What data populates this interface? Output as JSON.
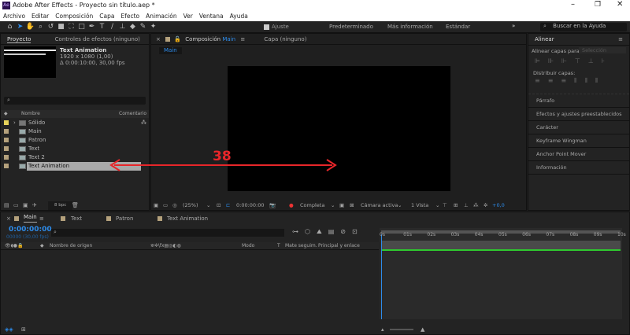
{
  "window": {
    "title": "Adobe After Effects - Proyecto sin título.aep *",
    "app_icon": "Ae",
    "controls": [
      "minimize-icon",
      "restore-icon",
      "close-icon"
    ]
  },
  "menu": [
    "Archivo",
    "Editar",
    "Composición",
    "Capa",
    "Efecto",
    "Animación",
    "Ver",
    "Ventana",
    "Ayuda"
  ],
  "toolbar": {
    "ajuste": "Ajuste",
    "workspaces": [
      "Predeterminado",
      "Más información",
      "Estándar"
    ],
    "search_placeholder": "Buscar en la Ayuda"
  },
  "project": {
    "tab": "Proyecto",
    "tab2": "Controles de efectos (ninguno)",
    "comp_name": "Text Animation",
    "dims": "1920 x 1080 (1,00)",
    "duration": "Δ 0:00:10:00, 30,00 fps",
    "col_name": "Nombre",
    "col_comment": "Comentario",
    "items": [
      "Sólido",
      "Main",
      "Patron",
      "Text",
      "Text 2",
      "Text Animation"
    ],
    "bpc": "8 bpc"
  },
  "composition": {
    "tab": "Composición",
    "tab_comp": "Main",
    "tab_layer": "Capa (ninguno)",
    "breadcrumb": "Main",
    "zoom": "(25%)",
    "timecode": "0:00:00:00",
    "resolution": "Completa",
    "camera": "Cámara activa",
    "views": "1 Vista",
    "exposure": "+0,0"
  },
  "annotation": {
    "label": "38",
    "color": "#e8262a"
  },
  "right_panel": {
    "title": "Alinear",
    "align_to_label": "Alinear capas para:",
    "align_to_value": "Selección",
    "distribute_label": "Distribuir capas:",
    "sections": [
      "Párrafo",
      "Efectos y ajustes preestablecidos",
      "Carácter",
      "Keyframe Wingman",
      "Anchor Point Mover",
      "Información"
    ]
  },
  "timeline": {
    "tabs": [
      "Main",
      "Text",
      "Patron",
      "Text Animation"
    ],
    "timecode": "0:00:00:00",
    "frames": "00000 (30,00 fps)",
    "columns": {
      "source": "Nombre de origen",
      "mode": "Modo",
      "t": "T",
      "matte": "Mate seguim.",
      "parent": "Principal y enlace"
    },
    "ruler": [
      "0s",
      "01s",
      "02s",
      "03s",
      "04s",
      "05s",
      "06s",
      "07s",
      "08s",
      "09s",
      "10s"
    ]
  },
  "colors": {
    "accent": "#2d8ceb",
    "label_tan": "#b4a17c",
    "label_yellow": "#e6d35a",
    "work_area_green": "#2ec82e"
  }
}
